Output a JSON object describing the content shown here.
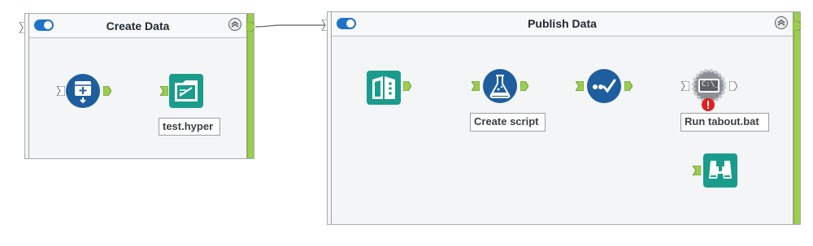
{
  "containers": {
    "create": {
      "title": "Create Data"
    },
    "publish": {
      "title": "Publish Data"
    }
  },
  "tools": {
    "input": {
      "icon": "text-input-icon"
    },
    "output": {
      "icon": "output-data-icon",
      "label": "test.hyper"
    },
    "reader": {
      "icon": "input-data-icon"
    },
    "formula": {
      "icon": "formula-icon",
      "label": "Create script"
    },
    "select": {
      "icon": "select-icon"
    },
    "run": {
      "icon": "run-command-icon",
      "label": "Run tabout.bat",
      "console_text": "C:\\_"
    },
    "browse": {
      "icon": "browse-icon"
    }
  },
  "colors": {
    "container_accent": "#9ccd4f",
    "anchor": "#9ccd4f",
    "toggle": "#1e73c8",
    "teal_tool": "#1a9c8c",
    "blue_tool": "#1f5e9e",
    "error": "#e02020"
  }
}
